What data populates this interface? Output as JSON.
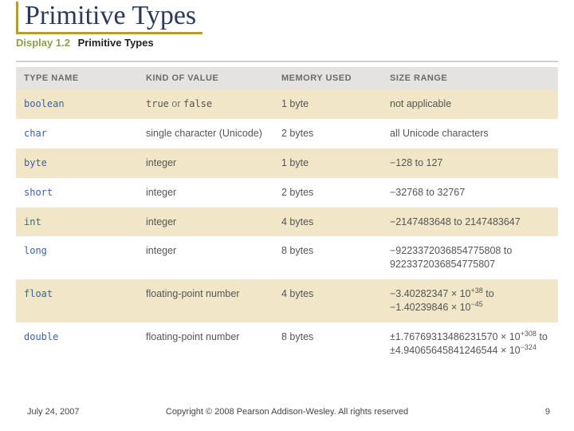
{
  "slide": {
    "title": "Primitive Types",
    "display_number": "Display 1.2",
    "display_title": "Primitive Types"
  },
  "table": {
    "headers": {
      "type_name": "TYPE NAME",
      "kind": "KIND OF VALUE",
      "memory": "MEMORY USED",
      "size": "SIZE RANGE"
    },
    "rows": [
      {
        "name": "boolean",
        "kind_html": "<span class='code'>true</span> <span class='muted'>or</span> <span class='code'>false</span>",
        "memory": "1 byte",
        "size_html": "not applicable"
      },
      {
        "name": "char",
        "kind_html": "single character (Unicode)",
        "memory": "2 bytes",
        "size_html": "all Unicode characters"
      },
      {
        "name": "byte",
        "kind_html": "integer",
        "memory": "1 byte",
        "size_html": "−128 to 127"
      },
      {
        "name": "short",
        "kind_html": "integer",
        "memory": "2 bytes",
        "size_html": "−32768 to 32767"
      },
      {
        "name": "int",
        "kind_html": "integer",
        "memory": "4 bytes",
        "size_html": "−2147483648 to 2147483647"
      },
      {
        "name": "long",
        "kind_html": "integer",
        "memory": "8 bytes",
        "size_html": "−9223372036854775808 to 9223372036854775807"
      },
      {
        "name": "float",
        "kind_html": "floating-point number",
        "memory": "4 bytes",
        "size_html": "−3.40282347 × 10<sup>+38</sup> to<br>−1.40239846 × 10<sup>−45</sup>"
      },
      {
        "name": "double",
        "kind_html": "floating-point number",
        "memory": "8 bytes",
        "size_html": "±1.76769313486231570 × 10<sup>+308</sup> to<br>±4.94065645841246544 × 10<sup>−324</sup>"
      }
    ]
  },
  "footer": {
    "date": "July 24, 2007",
    "copyright": "Copyright © 2008 Pearson Addison-Wesley. All rights reserved",
    "page": "9"
  }
}
